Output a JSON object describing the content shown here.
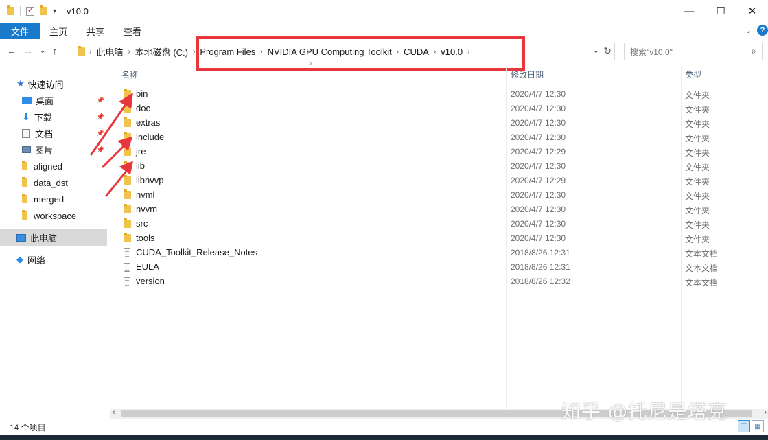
{
  "window": {
    "title": "v10.0",
    "buttons": {
      "minimize": "—",
      "maximize": "☐",
      "close": "✕"
    }
  },
  "ribbon": {
    "tabs": [
      "文件",
      "主页",
      "共享",
      "查看"
    ]
  },
  "address": {
    "breadcrumbs": [
      "此电脑",
      "本地磁盘 (C:)",
      "Program Files",
      "NVIDIA GPU Computing Toolkit",
      "CUDA",
      "v10.0"
    ],
    "highlight_color": "#e8363d"
  },
  "search": {
    "placeholder": "搜索\"v10.0\""
  },
  "sidebar": {
    "items": [
      {
        "label": "快速访问",
        "icon": "star-icon"
      },
      {
        "label": "桌面",
        "icon": "desktop-icon",
        "pinned": true
      },
      {
        "label": "下载",
        "icon": "download-icon",
        "pinned": true
      },
      {
        "label": "文档",
        "icon": "document-icon",
        "pinned": true
      },
      {
        "label": "图片",
        "icon": "picture-icon",
        "pinned": true
      },
      {
        "label": "aligned",
        "icon": "folder-icon"
      },
      {
        "label": "data_dst",
        "icon": "folder-icon"
      },
      {
        "label": "merged",
        "icon": "folder-icon"
      },
      {
        "label": "workspace",
        "icon": "folder-icon"
      },
      {
        "label": "此电脑",
        "icon": "computer-icon",
        "selected": true
      },
      {
        "label": "网络",
        "icon": "network-icon"
      }
    ]
  },
  "columns": {
    "name": "名称",
    "date": "修改日期",
    "type": "类型"
  },
  "files": [
    {
      "name": "bin",
      "date": "2020/4/7 12:30",
      "type": "文件夹",
      "kind": "folder"
    },
    {
      "name": "doc",
      "date": "2020/4/7 12:30",
      "type": "文件夹",
      "kind": "folder"
    },
    {
      "name": "extras",
      "date": "2020/4/7 12:30",
      "type": "文件夹",
      "kind": "folder"
    },
    {
      "name": "include",
      "date": "2020/4/7 12:30",
      "type": "文件夹",
      "kind": "folder"
    },
    {
      "name": "jre",
      "date": "2020/4/7 12:29",
      "type": "文件夹",
      "kind": "folder"
    },
    {
      "name": "lib",
      "date": "2020/4/7 12:30",
      "type": "文件夹",
      "kind": "folder"
    },
    {
      "name": "libnvvp",
      "date": "2020/4/7 12:29",
      "type": "文件夹",
      "kind": "folder"
    },
    {
      "name": "nvml",
      "date": "2020/4/7 12:30",
      "type": "文件夹",
      "kind": "folder"
    },
    {
      "name": "nvvm",
      "date": "2020/4/7 12:30",
      "type": "文件夹",
      "kind": "folder"
    },
    {
      "name": "src",
      "date": "2020/4/7 12:30",
      "type": "文件夹",
      "kind": "folder"
    },
    {
      "name": "tools",
      "date": "2020/4/7 12:30",
      "type": "文件夹",
      "kind": "folder"
    },
    {
      "name": "CUDA_Toolkit_Release_Notes",
      "date": "2018/8/26 12:31",
      "type": "文本文档",
      "kind": "text"
    },
    {
      "name": "EULA",
      "date": "2018/8/26 12:31",
      "type": "文本文档",
      "kind": "text"
    },
    {
      "name": "version",
      "date": "2018/8/26 12:32",
      "type": "文本文档",
      "kind": "text"
    }
  ],
  "status": {
    "count": "14 个项目"
  },
  "watermark": "知乎 @托尼是塔克",
  "annotation_color": "#e8363d"
}
